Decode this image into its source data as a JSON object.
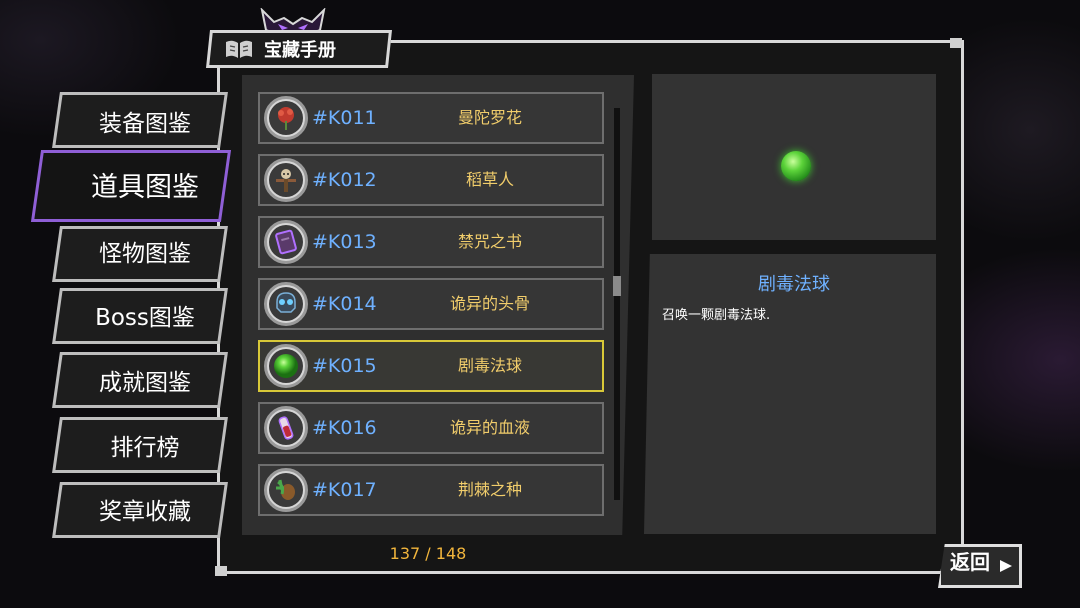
{
  "header": {
    "title": "宝藏手册"
  },
  "sidebar": {
    "items": [
      {
        "label": "装备图鉴",
        "active": false
      },
      {
        "label": "道具图鉴",
        "active": true
      },
      {
        "label": "怪物图鉴",
        "active": false
      },
      {
        "label": "Boss图鉴",
        "active": false
      },
      {
        "label": "成就图鉴",
        "active": false
      },
      {
        "label": "排行榜",
        "active": false
      },
      {
        "label": "奖章收藏",
        "active": false
      }
    ]
  },
  "list": {
    "items": [
      {
        "code": "#K011",
        "name": "曼陀罗花",
        "icon": "mandrake-flower-icon"
      },
      {
        "code": "#K012",
        "name": "稻草人",
        "icon": "scarecrow-icon"
      },
      {
        "code": "#K013",
        "name": "禁咒之书",
        "icon": "forbidden-book-icon"
      },
      {
        "code": "#K014",
        "name": "诡异的头骨",
        "icon": "weird-skull-icon"
      },
      {
        "code": "#K015",
        "name": "剧毒法球",
        "icon": "poison-orb-icon",
        "selected": true
      },
      {
        "code": "#K016",
        "name": "诡异的血液",
        "icon": "weird-blood-icon"
      },
      {
        "code": "#K017",
        "name": "荆棘之种",
        "icon": "thorn-seed-icon"
      }
    ],
    "page_count": "137 / 148"
  },
  "detail": {
    "title": "剧毒法球",
    "description": "召唤一颗剧毒法球."
  },
  "back_button": {
    "label": "返回"
  },
  "colors": {
    "accent_purple": "#8f5fd6",
    "code_blue": "#6fb1ff",
    "name_gold": "#f1cd6b",
    "selected_border": "#d8c838",
    "count_orange": "#f1b53c"
  }
}
